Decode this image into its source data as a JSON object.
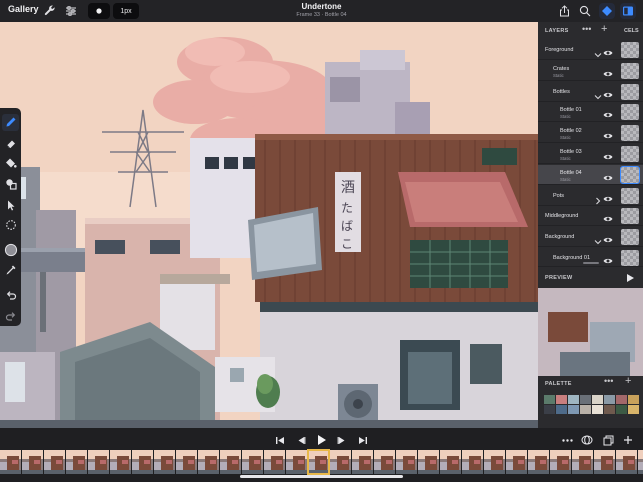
{
  "topbar": {
    "gallery_label": "Gallery",
    "document_title": "Undertone",
    "frame_subtitle": "Frame 33 · Bottle 04",
    "brush_size": "1px",
    "icons": [
      "wrench-icon",
      "sliders-icon",
      "brush-dot-icon",
      "share-icon",
      "zoom-icon",
      "layers-diamond-icon",
      "panels-icon"
    ]
  },
  "tools": [
    {
      "name": "pencil-icon",
      "active": true
    },
    {
      "name": "eraser-icon",
      "active": false
    },
    {
      "name": "fill-bucket-icon",
      "active": false
    },
    {
      "name": "shape-icon",
      "active": false
    },
    {
      "name": "move-cursor-icon",
      "active": false
    },
    {
      "name": "selection-icon",
      "active": false
    },
    {
      "name": "color-swatch-icon",
      "active": false
    },
    {
      "name": "eyedropper-icon",
      "active": false
    },
    {
      "name": "undo-icon",
      "active": false
    },
    {
      "name": "redo-icon",
      "active": false
    }
  ],
  "layers_panel": {
    "title": "LAYERS",
    "cels_title": "CELS",
    "preview_title": "PREVIEW",
    "layers": [
      {
        "name": "Foreground",
        "sub": "",
        "indent": 1,
        "chevron": "down",
        "selected": false
      },
      {
        "name": "Crates",
        "sub": "Static",
        "indent": 2,
        "chevron": "",
        "selected": false
      },
      {
        "name": "Bottles",
        "sub": "",
        "indent": 2,
        "chevron": "down",
        "selected": false
      },
      {
        "name": "Bottle 01",
        "sub": "Static",
        "indent": 3,
        "chevron": "",
        "selected": false
      },
      {
        "name": "Bottle 02",
        "sub": "Static",
        "indent": 3,
        "chevron": "",
        "selected": false
      },
      {
        "name": "Bottle 03",
        "sub": "Static",
        "indent": 3,
        "chevron": "",
        "selected": false
      },
      {
        "name": "Bottle 04",
        "sub": "Static",
        "indent": 3,
        "chevron": "",
        "selected": true
      },
      {
        "name": "Pots",
        "sub": "",
        "indent": 2,
        "chevron": "right",
        "selected": false
      },
      {
        "name": "Middleground",
        "sub": "",
        "indent": 1,
        "chevron": "",
        "selected": false
      },
      {
        "name": "Background",
        "sub": "",
        "indent": 1,
        "chevron": "down",
        "selected": false
      },
      {
        "name": "Background 01",
        "sub": "",
        "indent": 2,
        "chevron": "",
        "selected": false
      }
    ]
  },
  "palette": {
    "title": "PALETTE",
    "colors": [
      "#5b7b6b",
      "#c97f7f",
      "#9fb6c2",
      "#6a7078",
      "#d9d3c8",
      "#8a9aa6",
      "#a3686a",
      "#c8a15b",
      "#3b3f48",
      "#4e6b8a",
      "#7e98b3",
      "#b9b1a8",
      "#e9e1d6",
      "#6f5a4e",
      "#3c5a44",
      "#d8b46a"
    ]
  },
  "timeline": {
    "frame_count": 30,
    "current_frame_index": 14,
    "icons": [
      "skip-start-icon",
      "step-back-icon",
      "play-icon",
      "step-forward-icon",
      "skip-end-icon",
      "more-icon",
      "onion-skin-icon",
      "duplicate-frame-icon",
      "add-frame-icon"
    ]
  }
}
